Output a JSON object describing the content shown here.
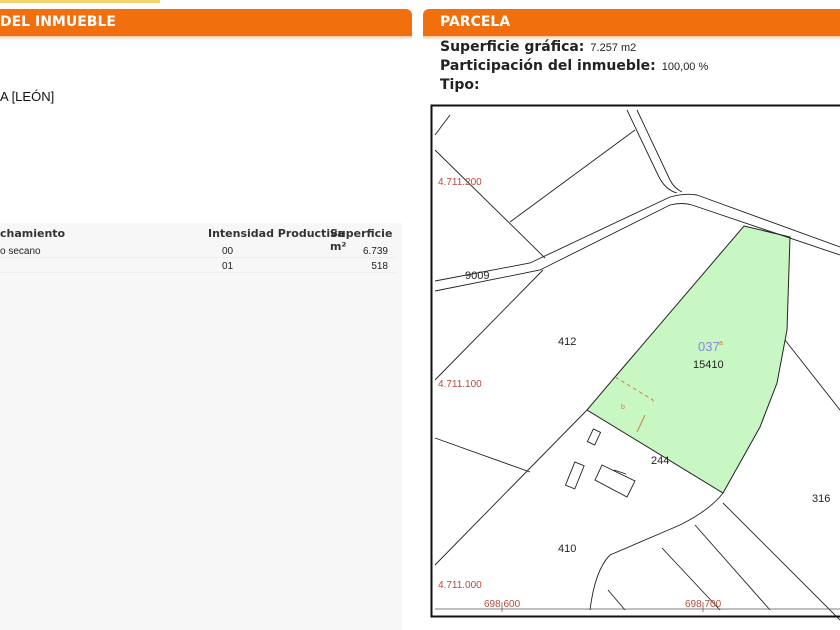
{
  "left": {
    "header": "DEL INMUEBLE",
    "location": "A [LEÓN]",
    "table": {
      "columns": [
        "chamiento",
        "Intensidad Productiva",
        "Superficie m²"
      ],
      "rows": [
        {
          "use": "o secano",
          "intensity": "00",
          "area": "6.739"
        },
        {
          "use": "",
          "intensity": "01",
          "area": "518"
        }
      ]
    }
  },
  "parcela": {
    "header": "PARCELA",
    "superficie_label": "Superficie gráfica:",
    "superficie_value": "7.257 m2",
    "participacion_label": "Participación del inmueble:",
    "participacion_value": "100,00 %",
    "tipo_label": "Tipo:"
  },
  "map": {
    "y_coords": [
      "4.711.200",
      "4.711.100",
      "4.711.000"
    ],
    "x_coords": [
      "698.600",
      "698.700"
    ],
    "labels": {
      "road": "9009",
      "p412": "412",
      "p037": "037",
      "sub_a": "a",
      "sub_b": "b",
      "p15410": "15410",
      "p244": "244",
      "p316": "316",
      "p410": "410"
    },
    "colors": {
      "highlight": "#c9f7c4",
      "accent": "#f26f0e"
    }
  }
}
